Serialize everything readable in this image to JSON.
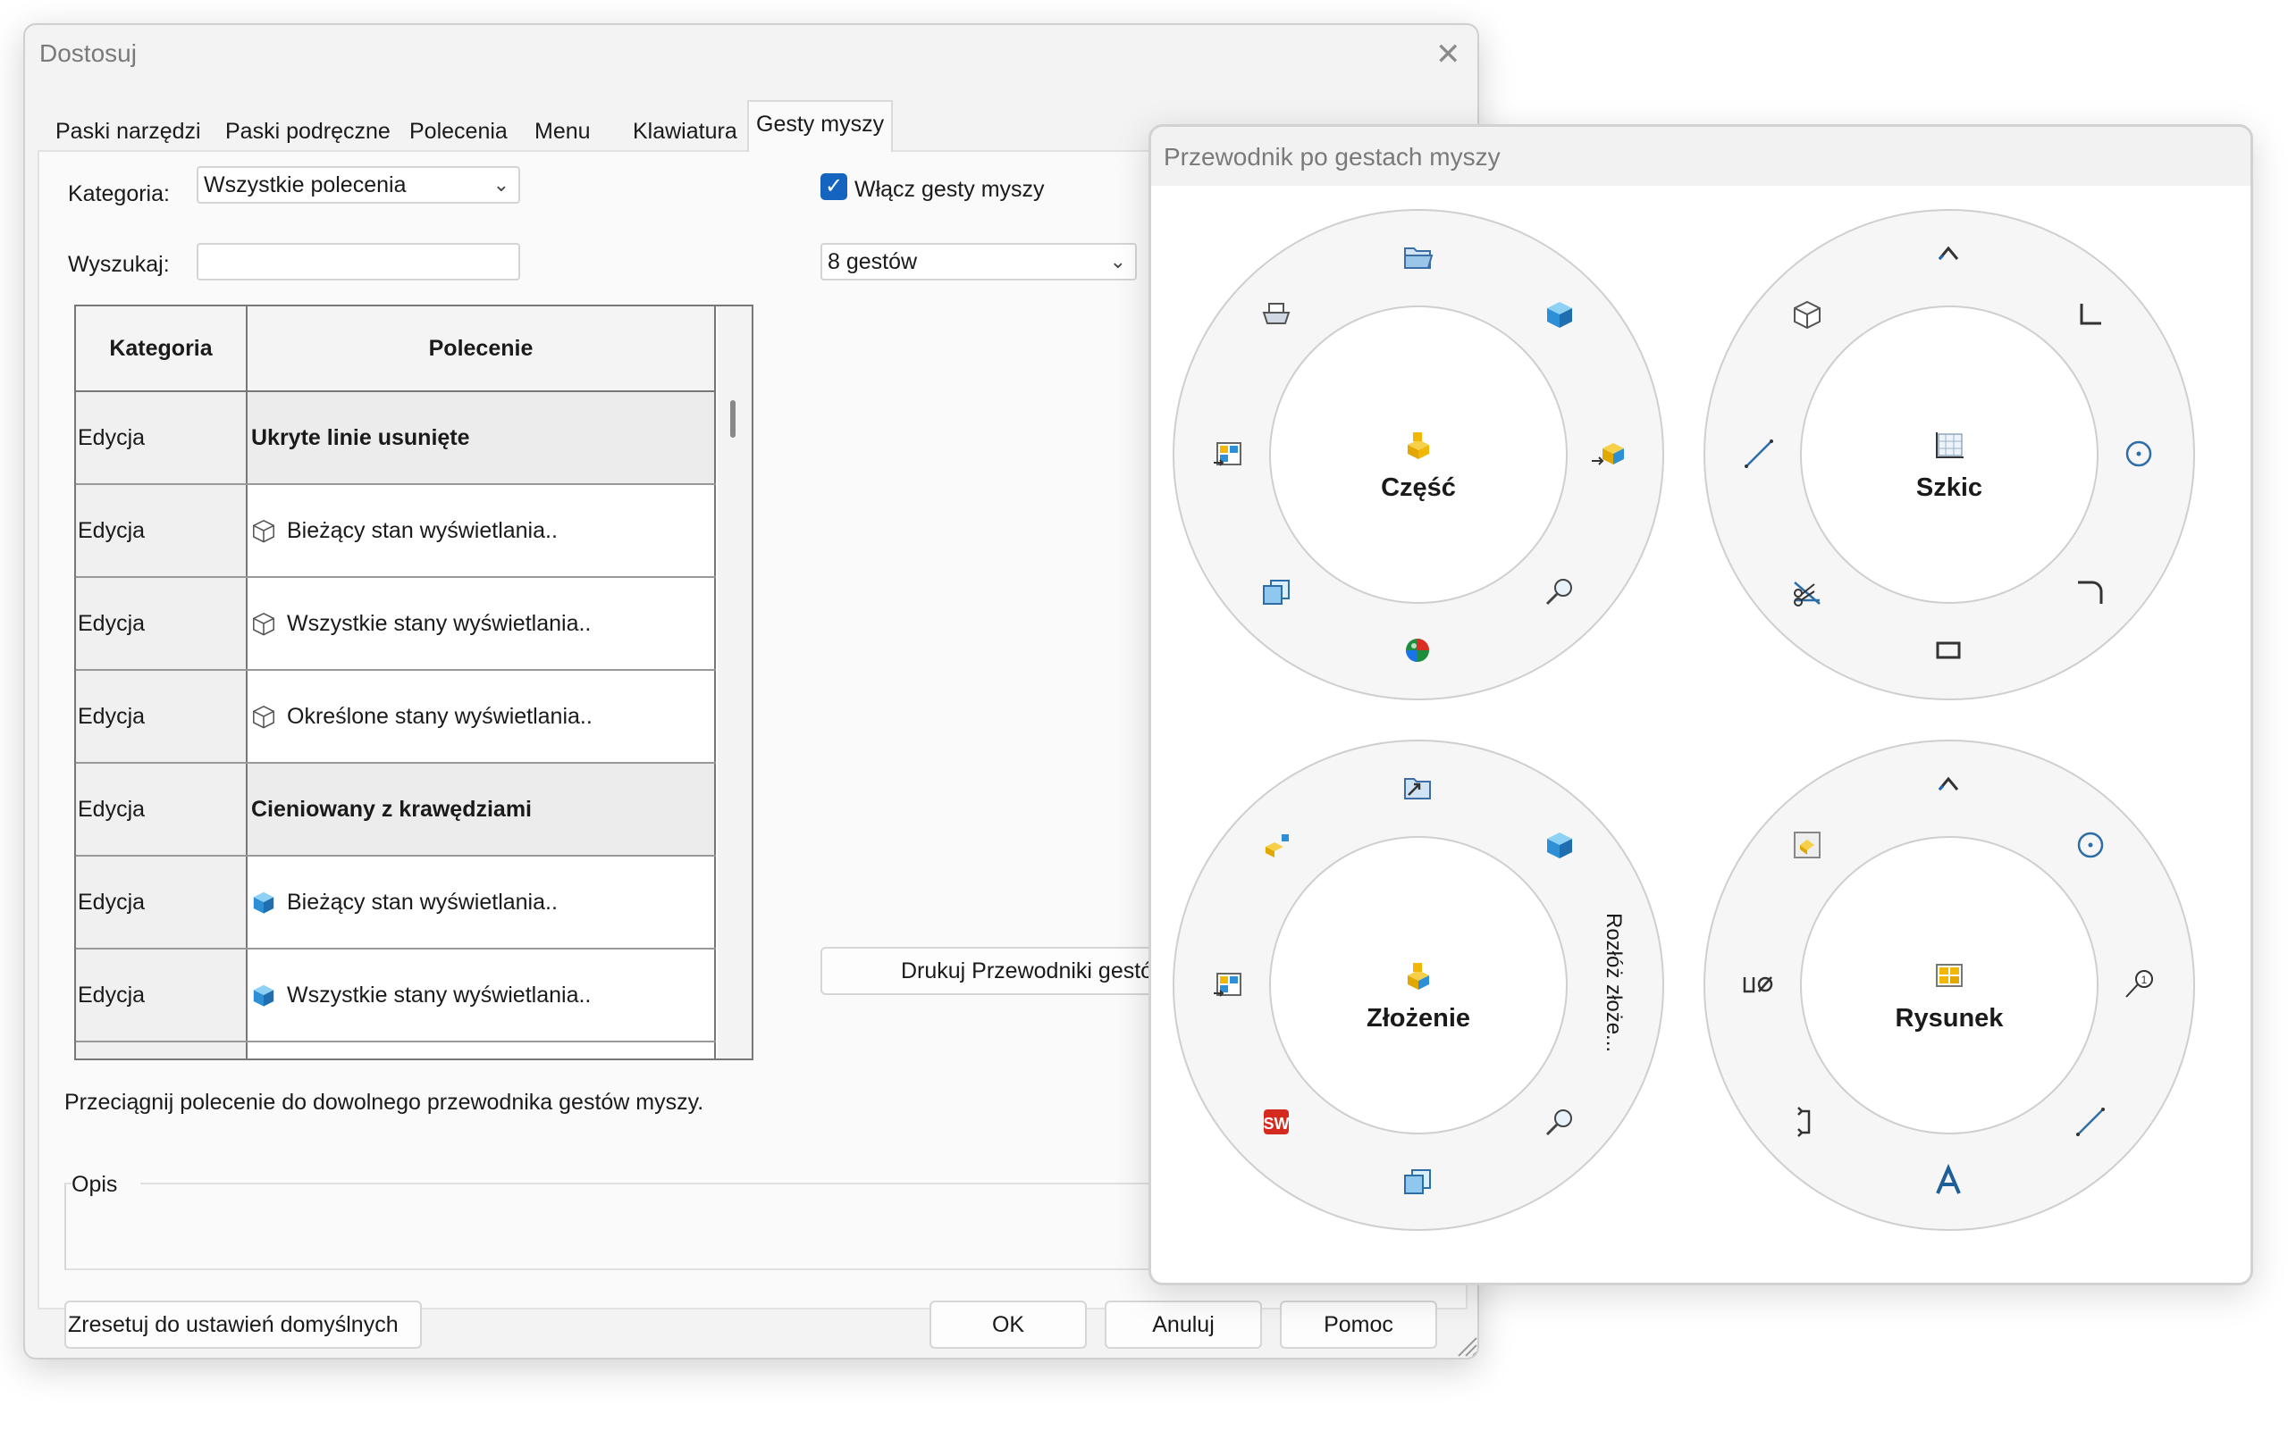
{
  "dialog": {
    "title": "Dostosuj",
    "tabs": [
      "Paski narzędzi",
      "Paski podręczne",
      "Polecenia",
      "Menu",
      "Klawiatura",
      "Gesty myszy"
    ],
    "active_tab": "Gesty myszy",
    "category_label": "Kategoria:",
    "category_value": "Wszystkie polecenia",
    "search_label": "Wyszukaj:",
    "search_value": "",
    "enable_label": "Włącz gesty myszy",
    "enable_checked": true,
    "gesture_count": "8 gestów",
    "print_button": "Drukuj Przewodniki gestó",
    "table": {
      "headers": [
        "Kategoria",
        "Polecenie"
      ],
      "rows": [
        {
          "category": "Edycja",
          "command": "Ukryte linie usunięte",
          "bold": true,
          "icon": "none"
        },
        {
          "category": "Edycja",
          "command": "Bieżący stan wyświetlania..",
          "bold": false,
          "icon": "wire-cube-icon"
        },
        {
          "category": "Edycja",
          "command": "Wszystkie stany wyświetlania..",
          "bold": false,
          "icon": "wire-cube-icon"
        },
        {
          "category": "Edycja",
          "command": "Określone stany wyświetlania..",
          "bold": false,
          "icon": "wire-cube-icon"
        },
        {
          "category": "Edycja",
          "command": "Cieniowany z krawędziami",
          "bold": true,
          "icon": "none"
        },
        {
          "category": "Edycja",
          "command": "Bieżący stan wyświetlania..",
          "bold": false,
          "icon": "shaded-cube-icon"
        },
        {
          "category": "Edycja",
          "command": "Wszystkie stany wyświetlania..",
          "bold": false,
          "icon": "shaded-cube-icon"
        }
      ]
    },
    "hint": "Przeciągnij polecenie do dowolnego przewodnika gestów myszy.",
    "description_label": "Opis",
    "reset_button": "Zresetuj do ustawień domyślnych",
    "ok_button": "OK",
    "cancel_button": "Anuluj",
    "help_button": "Pomoc"
  },
  "guide": {
    "title": "Przewodnik po gestach myszy",
    "wheels": [
      {
        "name": "Część"
      },
      {
        "name": "Szkic"
      },
      {
        "name": "Złożenie",
        "side_label": "Rozłóż złoże..."
      },
      {
        "name": "Rysunek"
      }
    ]
  },
  "colors": {
    "accent": "#1565c0",
    "cube": "#2d8fd5",
    "cube_face": "#65b8ee",
    "gold": "#f2b705"
  }
}
